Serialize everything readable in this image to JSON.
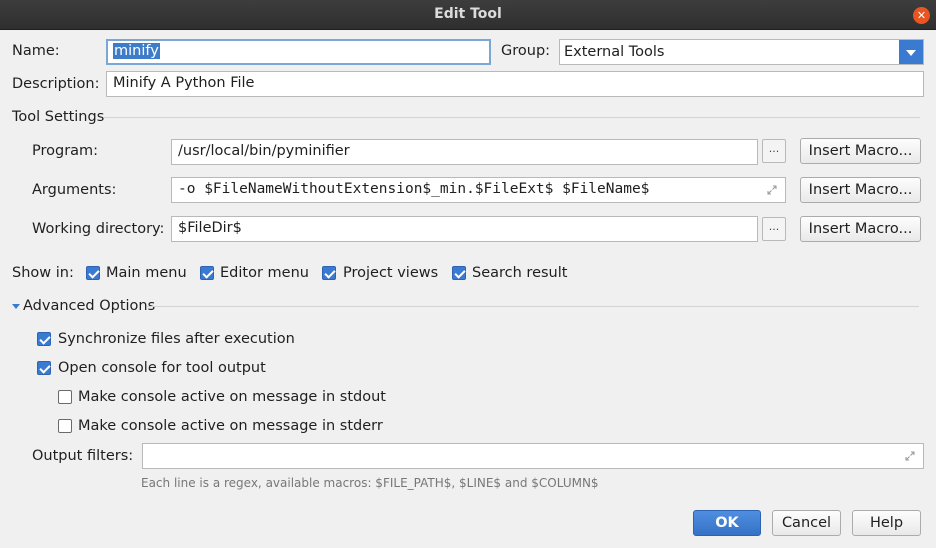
{
  "window": {
    "title": "Edit Tool"
  },
  "name": {
    "label": "Name:",
    "value": "minify"
  },
  "group": {
    "label": "Group:",
    "value": "External Tools"
  },
  "description": {
    "label": "Description:",
    "value": "Minify A Python File"
  },
  "tool_settings": {
    "heading": "Tool Settings",
    "program": {
      "label": "Program:",
      "value": "/usr/local/bin/pyminifier",
      "macro_button": "Insert Macro..."
    },
    "arguments": {
      "label": "Arguments:",
      "value": "-o $FileNameWithoutExtension$_min.$FileExt$ $FileName$",
      "macro_button": "Insert Macro..."
    },
    "working_directory": {
      "label": "Working directory:",
      "value": "$FileDir$",
      "macro_button": "Insert Macro..."
    },
    "browse_label": "..."
  },
  "show_in": {
    "label": "Show in:",
    "options": [
      {
        "label": "Main menu",
        "checked": true
      },
      {
        "label": "Editor menu",
        "checked": true
      },
      {
        "label": "Project views",
        "checked": true
      },
      {
        "label": "Search result",
        "checked": true
      }
    ]
  },
  "advanced": {
    "heading": "Advanced Options",
    "sync": {
      "label": "Synchronize files after execution",
      "checked": true
    },
    "open_console": {
      "label": "Open console for tool output",
      "checked": true
    },
    "active_stdout": {
      "label": "Make console active on message in stdout",
      "checked": false
    },
    "active_stderr": {
      "label": "Make console active on message in stderr",
      "checked": false
    },
    "output_filters": {
      "label": "Output filters:",
      "value": "",
      "hint": "Each line is a regex, available macros: $FILE_PATH$, $LINE$ and $COLUMN$"
    }
  },
  "buttons": {
    "ok": "OK",
    "cancel": "Cancel",
    "help": "Help"
  },
  "icons": {
    "close": "close-icon",
    "dropdown": "chevron-down-icon",
    "expand": "expand-icon",
    "collapse": "triangle-down-icon"
  },
  "colors": {
    "accent": "#3b7ad1",
    "titlebar": "#353535",
    "close": "#e95420"
  }
}
